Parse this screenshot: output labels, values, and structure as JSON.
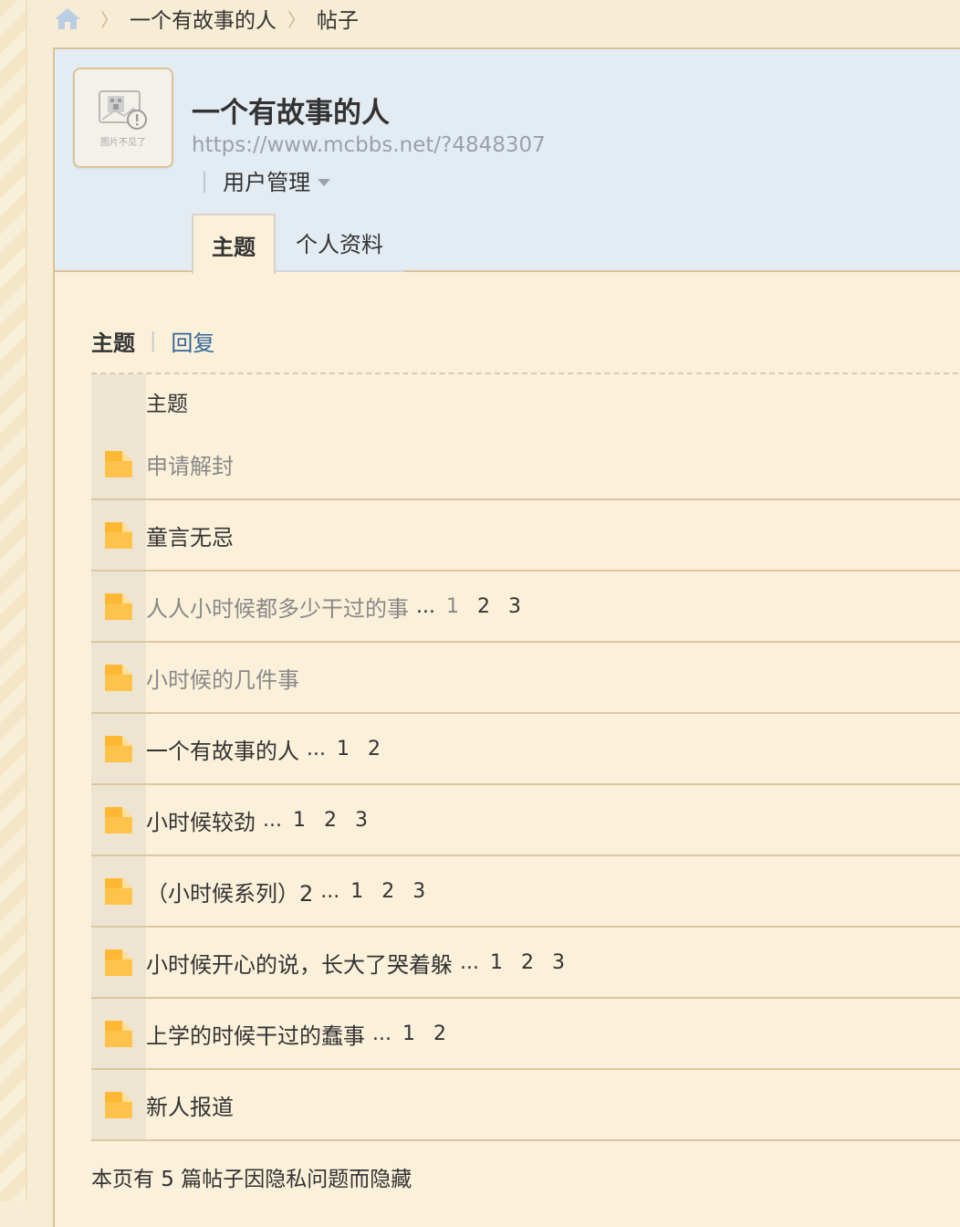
{
  "breadcrumb": {
    "home_icon": "home-icon",
    "items": [
      "一个有故事的人",
      "帖子"
    ],
    "separator": "〉"
  },
  "profile": {
    "avatar_caption": "图片不见了",
    "name": "一个有故事的人",
    "url": "https://www.mcbbs.net/?4848307",
    "user_management": "用户管理",
    "tabs": [
      "主题",
      "个人资料"
    ],
    "active_tab": "主题"
  },
  "subtabs": {
    "active": "主题",
    "link": "回复",
    "separator": "|"
  },
  "table": {
    "header": "主题",
    "rows": [
      {
        "title": "申请解封",
        "visited": true,
        "ellipsis": "",
        "pages": []
      },
      {
        "title": "童言无忌",
        "visited": false,
        "ellipsis": "",
        "pages": []
      },
      {
        "title": "人人小时候都多少干过的事",
        "visited": true,
        "ellipsis": "...",
        "pages": [
          "1",
          "2",
          "3"
        ]
      },
      {
        "title": "小时候的几件事",
        "visited": true,
        "ellipsis": "",
        "pages": []
      },
      {
        "title": "一个有故事的人",
        "visited": false,
        "ellipsis": "...",
        "pages": [
          "1",
          "2"
        ]
      },
      {
        "title": "小时候较劲",
        "visited": false,
        "ellipsis": "...",
        "pages": [
          "1",
          "2",
          "3"
        ]
      },
      {
        "title": "（小时候系列）2",
        "visited": false,
        "ellipsis": "...",
        "pages": [
          "1",
          "2",
          "3"
        ]
      },
      {
        "title": "小时候开心的说，长大了哭着躲",
        "visited": false,
        "ellipsis": "...",
        "pages": [
          "1",
          "2",
          "3"
        ]
      },
      {
        "title": "上学的时候干过的蠢事",
        "visited": false,
        "ellipsis": "...",
        "pages": [
          "1",
          "2"
        ]
      },
      {
        "title": "新人报道",
        "visited": false,
        "ellipsis": "",
        "pages": []
      }
    ]
  },
  "footer_note": "本页有 5 篇帖子因隐私问题而隐藏",
  "colors": {
    "background": "#f7ecd4",
    "header_bg": "#e4ecf3",
    "link_blue": "#336699",
    "visited_gray": "#888888",
    "folder_orange": "#ffb833"
  }
}
